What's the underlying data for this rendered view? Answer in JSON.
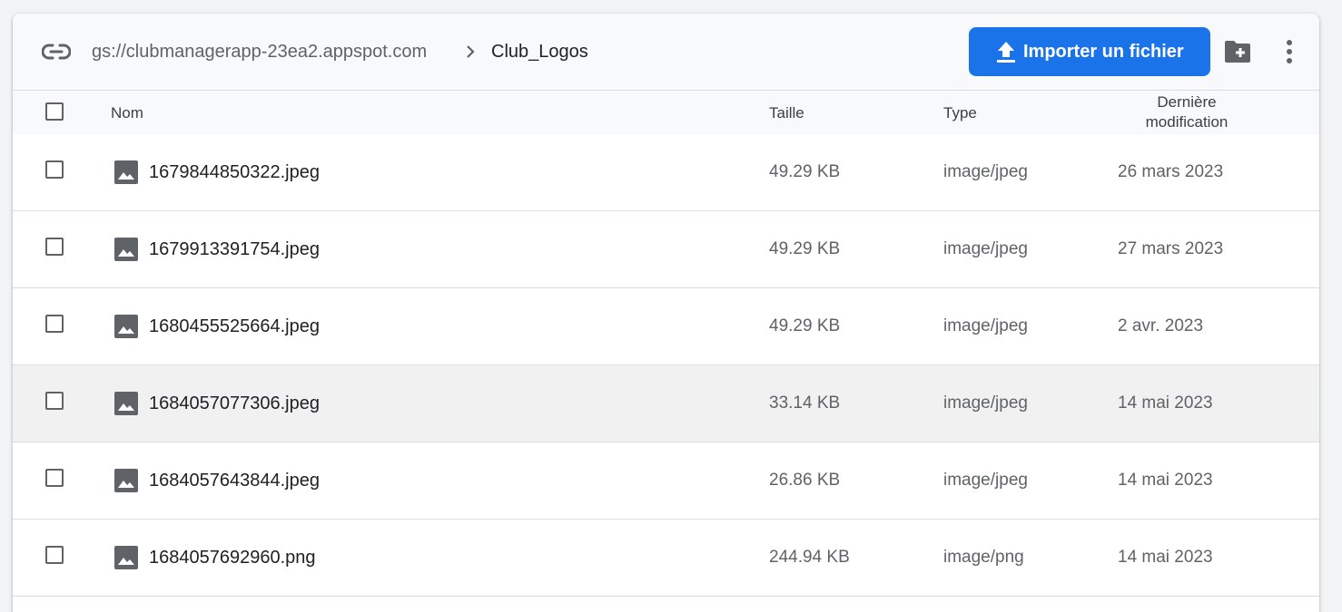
{
  "toolbar": {
    "link_icon": "link-icon",
    "bucket_path": "gs://clubmanagerapp-23ea2.appspot.com",
    "separator_icon": "chevron-right-icon",
    "current_folder": "Club_Logos",
    "upload_label": "Importer un fichier",
    "upload_icon": "upload-icon",
    "new_folder_icon": "create-folder-icon",
    "more_icon": "more-vert-icon",
    "accent_color": "#1a73e8"
  },
  "table": {
    "headers": {
      "name": "Nom",
      "size": "Taille",
      "type": "Type",
      "modified_line1": "Dernière",
      "modified_line2": "modification"
    },
    "rows": [
      {
        "name": "1679844850322.jpeg",
        "size": "49.29 KB",
        "type": "image/jpeg",
        "modified": "26 mars 2023"
      },
      {
        "name": "1679913391754.jpeg",
        "size": "49.29 KB",
        "type": "image/jpeg",
        "modified": "27 mars 2023"
      },
      {
        "name": "1680455525664.jpeg",
        "size": "49.29 KB",
        "type": "image/jpeg",
        "modified": "2 avr. 2023"
      },
      {
        "name": "1684057077306.jpeg",
        "size": "33.14 KB",
        "type": "image/jpeg",
        "modified": "14 mai 2023"
      },
      {
        "name": "1684057643844.jpeg",
        "size": "26.86 KB",
        "type": "image/jpeg",
        "modified": "14 mai 2023"
      },
      {
        "name": "1684057692960.png",
        "size": "244.94 KB",
        "type": "image/png",
        "modified": "14 mai 2023"
      }
    ]
  }
}
